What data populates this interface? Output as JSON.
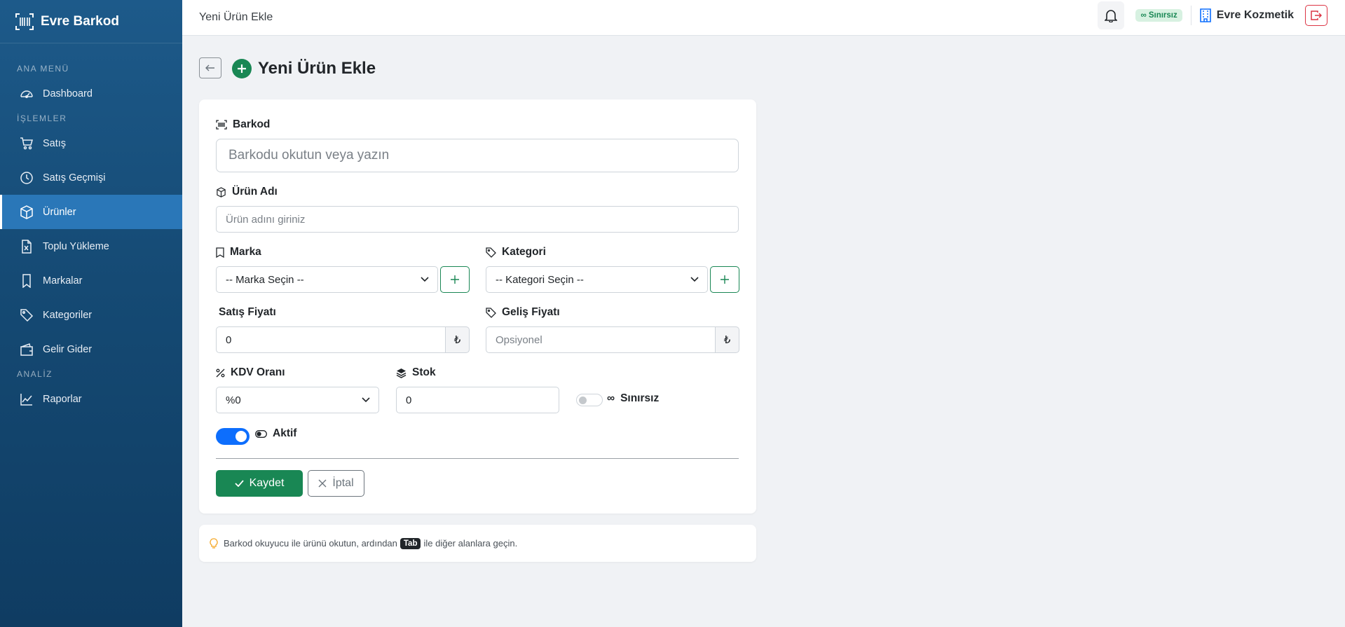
{
  "app": {
    "name": "Evre Barkod"
  },
  "sidebar": {
    "sections": [
      {
        "title": "ANA MENÜ"
      },
      {
        "title": "İŞLEMLER"
      },
      {
        "title": "ANALİZ"
      }
    ],
    "items": [
      {
        "label": "Dashboard",
        "icon": "speedometer-icon"
      },
      {
        "label": "Satış",
        "icon": "cart-icon"
      },
      {
        "label": "Satış Geçmişi",
        "icon": "clock-icon"
      },
      {
        "label": "Ürünler",
        "icon": "box-icon",
        "active": true
      },
      {
        "label": "Toplu Yükleme",
        "icon": "excel-file-icon"
      },
      {
        "label": "Markalar",
        "icon": "bookmark-icon"
      },
      {
        "label": "Kategoriler",
        "icon": "tags-icon"
      },
      {
        "label": "Gelir Gider",
        "icon": "wallet-icon"
      },
      {
        "label": "Raporlar",
        "icon": "line-chart-icon"
      }
    ]
  },
  "topbar": {
    "title": "Yeni Ürün Ekle",
    "badge": "∞ Sınırsız",
    "company": "Evre Kozmetik"
  },
  "page": {
    "title": "Yeni Ürün Ekle"
  },
  "form": {
    "barcode": {
      "label": "Barkod",
      "placeholder": "Barkodu okutun veya yazın"
    },
    "name": {
      "label": "Ürün Adı",
      "placeholder": "Ürün adını giriniz"
    },
    "brand": {
      "label": "Marka",
      "selected": "-- Marka Seçin --"
    },
    "category": {
      "label": "Kategori",
      "selected": "-- Kategori Seçin --"
    },
    "sale_price": {
      "label": "Satış Fiyatı",
      "value": "0",
      "currency": "₺"
    },
    "cost_price": {
      "label": "Geliş Fiyatı",
      "placeholder": "Opsiyonel",
      "currency": "₺"
    },
    "vat": {
      "label": "KDV Oranı",
      "selected": "%0"
    },
    "stock": {
      "label": "Stok",
      "value": "0"
    },
    "unlimited": {
      "label": "Sınırsız",
      "prefix": "∞",
      "checked": false
    },
    "active": {
      "label": "Aktif",
      "checked": true
    },
    "save_label": "Kaydet",
    "cancel_label": "İptal"
  },
  "info": {
    "text_before": "Barkod okuyucu ile ürünü okutun, ardından",
    "key": "Tab",
    "text_after": "ile diğer alanlara geçin."
  },
  "colors": {
    "sidebar_top": "#1d5a8a",
    "sidebar_active": "#2a77b8",
    "primary_green": "#198754",
    "toggle_blue": "#0d6efd",
    "danger": "#dc3545"
  }
}
